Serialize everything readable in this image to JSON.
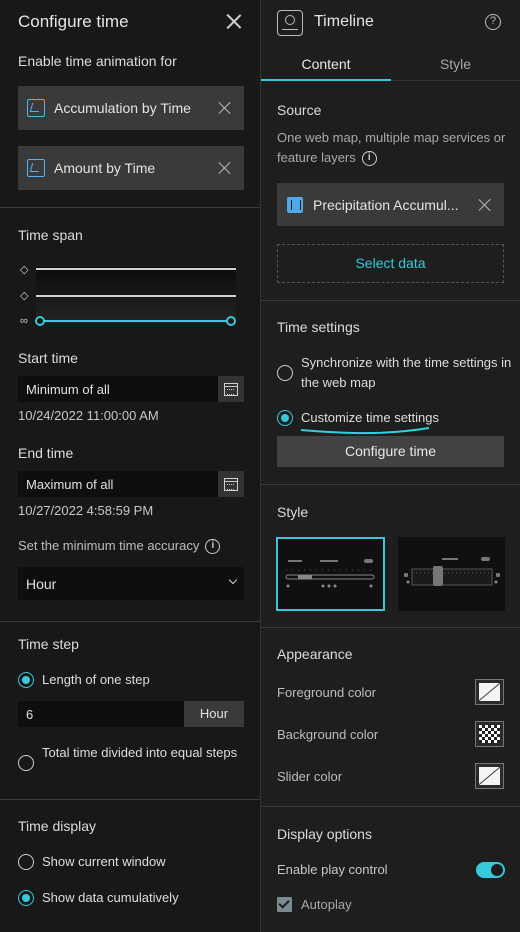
{
  "left": {
    "title": "Configure time",
    "enable_label": "Enable time animation for",
    "layers": [
      {
        "label": "Accumulation by Time"
      },
      {
        "label": "Amount by Time"
      }
    ],
    "time_span": {
      "title": "Time span",
      "start_label": "Start time",
      "start_value": "Minimum of all",
      "start_date": "10/24/2022 11:00:00 AM",
      "end_label": "End time",
      "end_value": "Maximum of all",
      "end_date": "10/27/2022 4:58:59 PM",
      "accuracy_label": "Set the minimum time accuracy",
      "accuracy_value": "Hour"
    },
    "time_step": {
      "title": "Time step",
      "option_length": "Length of one step",
      "step_value": "6",
      "step_unit": "Hour",
      "option_divided": "Total time divided into equal steps"
    },
    "time_display": {
      "title": "Time display",
      "option_current": "Show current window",
      "option_cumulative": "Show data cumulatively"
    }
  },
  "right": {
    "title": "Timeline",
    "tabs": [
      "Content",
      "Style"
    ],
    "source": {
      "title": "Source",
      "description": "One web map, multiple map services or feature layers",
      "chip_label": "Precipitation Accumul...",
      "select_data": "Select data"
    },
    "time_settings": {
      "title": "Time settings",
      "option_sync": "Synchronize with the time settings in the web map",
      "option_custom": "Customize time settings",
      "configure_button": "Configure time"
    },
    "style": {
      "title": "Style"
    },
    "appearance": {
      "title": "Appearance",
      "foreground": "Foreground color",
      "background": "Background color",
      "slider": "Slider color"
    },
    "display_options": {
      "title": "Display options",
      "play_control": "Enable play control",
      "autoplay": "Autoplay"
    }
  },
  "colors": {
    "accent": "#38c8dc",
    "panel": "#181818",
    "chip": "#3a3a3a"
  }
}
